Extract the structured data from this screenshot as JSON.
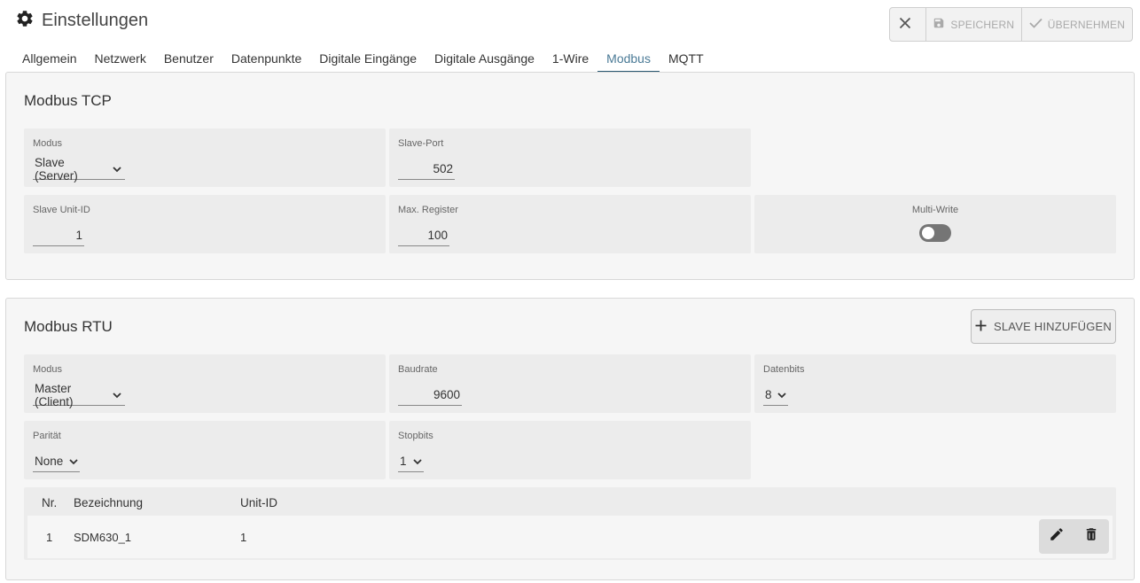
{
  "header": {
    "title": "Einstellungen",
    "icon": "gear-icon",
    "actions": {
      "close_icon": "close-icon",
      "save_label": "SPEICHERN",
      "apply_label": "ÜBERNEHMEN"
    }
  },
  "tabs": [
    {
      "label": "Allgemein"
    },
    {
      "label": "Netzwerk"
    },
    {
      "label": "Benutzer"
    },
    {
      "label": "Datenpunkte"
    },
    {
      "label": "Digitale Eingänge"
    },
    {
      "label": "Digitale Ausgänge"
    },
    {
      "label": "1-Wire"
    },
    {
      "label": "Modbus",
      "active": true
    },
    {
      "label": "MQTT"
    }
  ],
  "modbus_tcp": {
    "title": "Modbus TCP",
    "modus": {
      "label": "Modus",
      "value": "Slave (Server)"
    },
    "slave_port": {
      "label": "Slave-Port",
      "value": "502"
    },
    "slave_unit_id": {
      "label": "Slave Unit-ID",
      "value": "1"
    },
    "max_register": {
      "label": "Max. Register",
      "value": "100"
    },
    "multi_write": {
      "label": "Multi-Write",
      "enabled": false
    }
  },
  "modbus_rtu": {
    "title": "Modbus RTU",
    "add_slave_label": "SLAVE HINZUFÜGEN",
    "modus": {
      "label": "Modus",
      "value": "Master (Client)"
    },
    "baudrate": {
      "label": "Baudrate",
      "value": "9600"
    },
    "datenbits": {
      "label": "Datenbits",
      "value": "8"
    },
    "paritaet": {
      "label": "Parität",
      "value": "None"
    },
    "stopbits": {
      "label": "Stopbits",
      "value": "1"
    },
    "table": {
      "columns": [
        "Nr.",
        "Bezeichnung",
        "Unit-ID"
      ],
      "rows": [
        {
          "nr": "1",
          "bezeichnung": "SDM630_1",
          "unit_id": "1"
        }
      ]
    }
  },
  "colors": {
    "accent": "#2c5a73",
    "active_tab_text": "#4a7a96",
    "card_bg": "#f6f6f6",
    "field_bg": "#ececec"
  }
}
